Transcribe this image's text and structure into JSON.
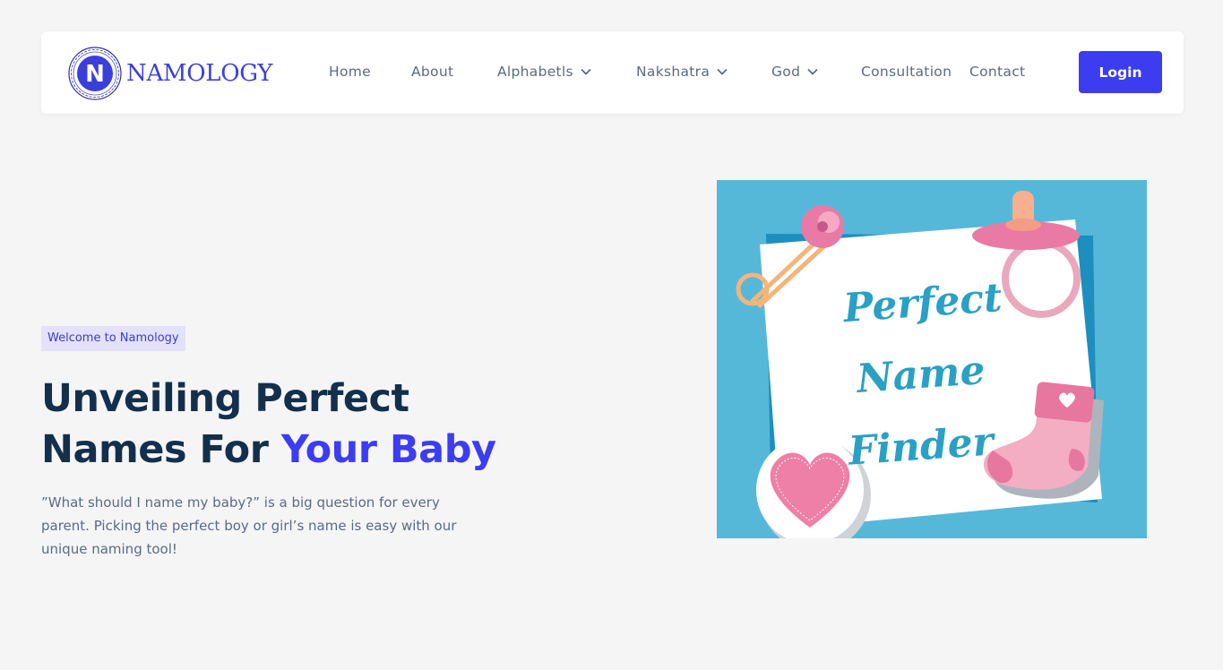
{
  "brand": {
    "name": "NAMOLOGY",
    "logo_letter": "N"
  },
  "nav": {
    "items": [
      {
        "label": "Home",
        "has_dropdown": false
      },
      {
        "label": "About",
        "has_dropdown": false
      },
      {
        "label": "Alphabetls",
        "has_dropdown": true
      },
      {
        "label": "Nakshatra",
        "has_dropdown": true
      },
      {
        "label": "God",
        "has_dropdown": true
      },
      {
        "label": "Consultation",
        "has_dropdown": false
      },
      {
        "label": "Contact",
        "has_dropdown": false
      }
    ],
    "login_label": "Login"
  },
  "hero": {
    "badge": "Welcome to Namology",
    "title_part1": "Unveiling Perfect Names For ",
    "title_accent": "Your Baby",
    "description": "”What should I name my baby?” is a big question for every parent. Picking the perfect boy or girl’s name is easy with our unique naming tool!",
    "image": {
      "text_line1": "Perfect",
      "text_line2": "Name",
      "text_line3": "Finder"
    }
  },
  "colors": {
    "accent": "#3c3df0",
    "heading": "#132f4c",
    "body_text": "#5a6a85",
    "badge_bg": "#e3e1fb",
    "page_bg": "#f5f5f6",
    "image_bg": "#56b8d8",
    "script_text": "#2aa0c4",
    "pink": "#e9799f"
  }
}
